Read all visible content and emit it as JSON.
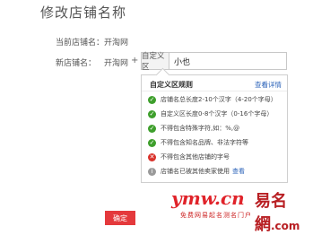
{
  "page": {
    "title": "修改店铺名称"
  },
  "current": {
    "label": "当前店铺名：",
    "value": "开淘网"
  },
  "new_name": {
    "label": "新店铺名：",
    "prefix": "开淘网",
    "plus": "+",
    "custom_tag": "自定义区",
    "value": "小也"
  },
  "rules": {
    "title": "自定义区规则",
    "detail_link": "查看详情",
    "items": [
      {
        "status": "ok",
        "text": "店铺名总长度2-10个汉字（4-20个字母）"
      },
      {
        "status": "ok",
        "text": "自定义区长度0-8个汉字（0-16个字母）"
      },
      {
        "status": "ok",
        "text": "不得包含特殊字符,如：%,@"
      },
      {
        "status": "ok",
        "text": "不得包含知名品牌、非法字符等"
      },
      {
        "status": "bad",
        "text": "不得包含其他店铺的字号"
      },
      {
        "status": "info",
        "text": "店铺名已被其他卖家使用",
        "link": "查看"
      }
    ]
  },
  "watermark": {
    "logo_text": "ymw.cn",
    "cn_name": "易名網",
    "domain_suffix": ".com",
    "tagline": "免费网易起名测名门户"
  },
  "actions": {
    "confirm_label": "确定"
  },
  "colors": {
    "accent": "#e4393c",
    "ok": "#3e9f2c",
    "bad": "#d9312a",
    "link": "#2a62b8"
  }
}
